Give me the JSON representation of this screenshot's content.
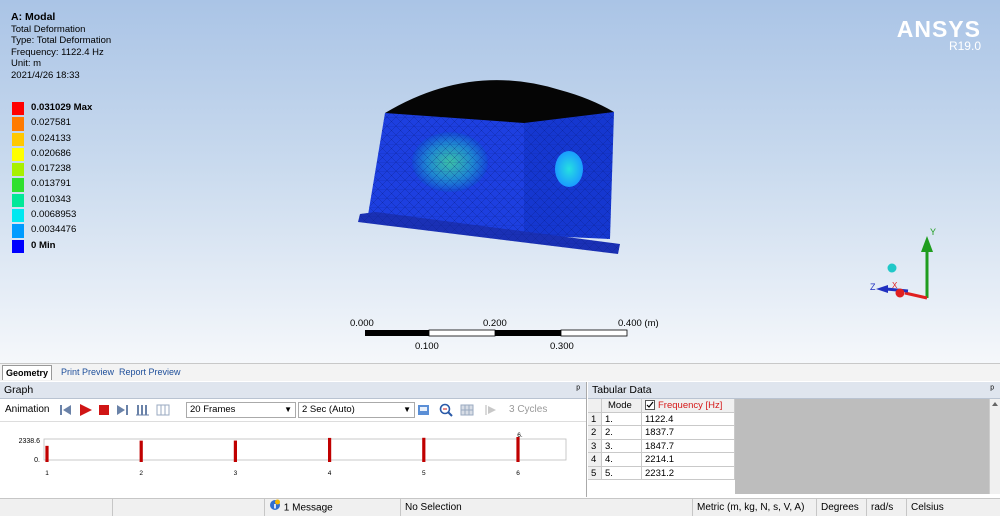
{
  "viewport": {
    "title": "A: Modal",
    "lines": [
      "Total Deformation",
      "Type: Total Deformation",
      "Frequency: 1122.4 Hz",
      "Unit: m",
      "2021/4/26 18:33"
    ],
    "legend": [
      {
        "label": "0.031029 Max",
        "color": "#ff0000",
        "bold": true
      },
      {
        "label": "0.027581",
        "color": "#ff7a00",
        "bold": false
      },
      {
        "label": "0.024133",
        "color": "#ffc800",
        "bold": false
      },
      {
        "label": "0.020686",
        "color": "#ffff00",
        "bold": false
      },
      {
        "label": "0.017238",
        "color": "#a8f000",
        "bold": false
      },
      {
        "label": "0.013791",
        "color": "#2ee02e",
        "bold": false
      },
      {
        "label": "0.010343",
        "color": "#00e898",
        "bold": false
      },
      {
        "label": "0.0068953",
        "color": "#00e8f0",
        "bold": false
      },
      {
        "label": "0.0034476",
        "color": "#009cff",
        "bold": false
      },
      {
        "label": "0 Min",
        "color": "#0000ff",
        "bold": true
      }
    ],
    "logo": {
      "brand": "ANSYS",
      "version": "R19.0"
    },
    "scale_bar": {
      "top_labels": [
        "0.000",
        "0.200",
        "0.400 (m)"
      ],
      "bottom_labels": [
        "0.100",
        "0.300"
      ]
    },
    "triad_labels": {
      "y": "Y",
      "z": "Z",
      "x": "X"
    }
  },
  "view_tabs": [
    "Geometry",
    "Print Preview",
    "Report Preview"
  ],
  "graph_panel": {
    "title": "Graph",
    "pin": "ᵖ",
    "animation_label": "Animation",
    "frames": "20 Frames",
    "duration": "2 Sec (Auto)",
    "cycles": "3 Cycles",
    "chart": {
      "ymax_label": "2338.6",
      "ymin_label": "0.",
      "x_labels": [
        "1",
        "2",
        "3",
        "4",
        "5",
        "6"
      ],
      "top_label": "6."
    }
  },
  "tabular_panel": {
    "title": "Tabular Data",
    "pin": "ᵖ",
    "columns": [
      "Mode",
      "Frequency [Hz]"
    ],
    "rows": [
      {
        "idx": "1",
        "mode": "1.",
        "freq": "1122.4"
      },
      {
        "idx": "2",
        "mode": "2.",
        "freq": "1837.7"
      },
      {
        "idx": "3",
        "mode": "3.",
        "freq": "1847.7"
      },
      {
        "idx": "4",
        "mode": "4.",
        "freq": "2214.1"
      },
      {
        "idx": "5",
        "mode": "5.",
        "freq": "2231.2"
      }
    ]
  },
  "chart_data": {
    "type": "bar",
    "categories": [
      "1",
      "2",
      "3",
      "4",
      "5",
      "6"
    ],
    "values": [
      1122.4,
      1837.7,
      1847.7,
      2214.1,
      2231.2,
      2338.6
    ],
    "ylim": [
      0,
      2338.6
    ],
    "xlabel": "",
    "ylabel": "",
    "grid": false
  },
  "status_bar": {
    "messages": "1 Message",
    "selection": "No Selection",
    "units": "Metric (m, kg, N, s, V, A)",
    "angle": "Degrees",
    "rate": "rad/s",
    "temp": "Celsius"
  },
  "colors": {
    "accent": "#d51818",
    "bar": "#c00000",
    "header_bg": "#dfe5ee"
  }
}
